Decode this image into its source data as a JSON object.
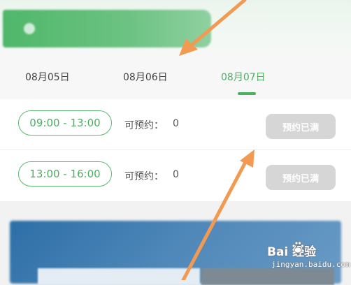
{
  "dates": [
    {
      "label": "08月05日",
      "active": false
    },
    {
      "label": "08月06日",
      "active": false
    },
    {
      "label": "08月07日",
      "active": true
    }
  ],
  "slots": [
    {
      "time": "09:00 - 13:00",
      "available_label": "可预约：",
      "available_count": "0",
      "button_label": "预约已满"
    },
    {
      "time": "13:00 - 16:00",
      "available_label": "可预约：",
      "available_count": "0",
      "button_label": "预约已满"
    }
  ],
  "watermark": {
    "main": "Bai  经验",
    "sub": "jingyan.baidu.com"
  },
  "colors": {
    "accent": "#4caf62",
    "button_disabled": "#d6d6d6",
    "annotation_arrow": "#f29a52"
  },
  "icons": {
    "arrow": "annotation-arrow",
    "paw": "baidu-paw-icon"
  }
}
